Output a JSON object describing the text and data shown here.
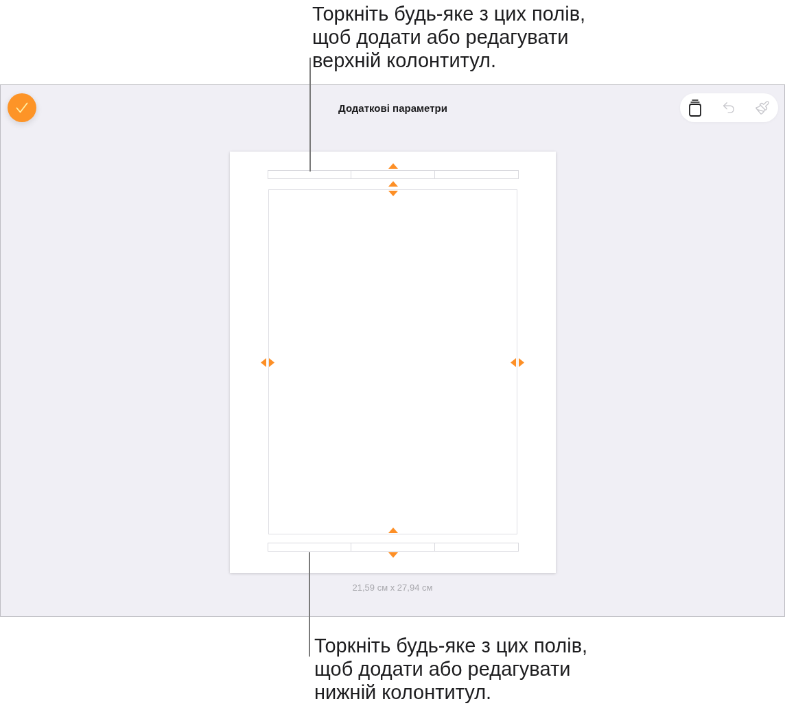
{
  "top_callout": {
    "lines": [
      "Торкніть будь-яке з цих полів,",
      "щоб додати або редагувати",
      "верхній колонтитул."
    ]
  },
  "screen": {
    "title": "Додаткові параметри",
    "toolbar": [
      {
        "disabled": false
      },
      {
        "disabled": true
      },
      {
        "disabled": true
      }
    ],
    "page_size": "21,59 см x 27,94 см"
  },
  "bottom_callout": {
    "lines": [
      "Торкніть будь-яке з цих полів,",
      "щоб додати або редагувати",
      "нижній колонтитул."
    ]
  }
}
